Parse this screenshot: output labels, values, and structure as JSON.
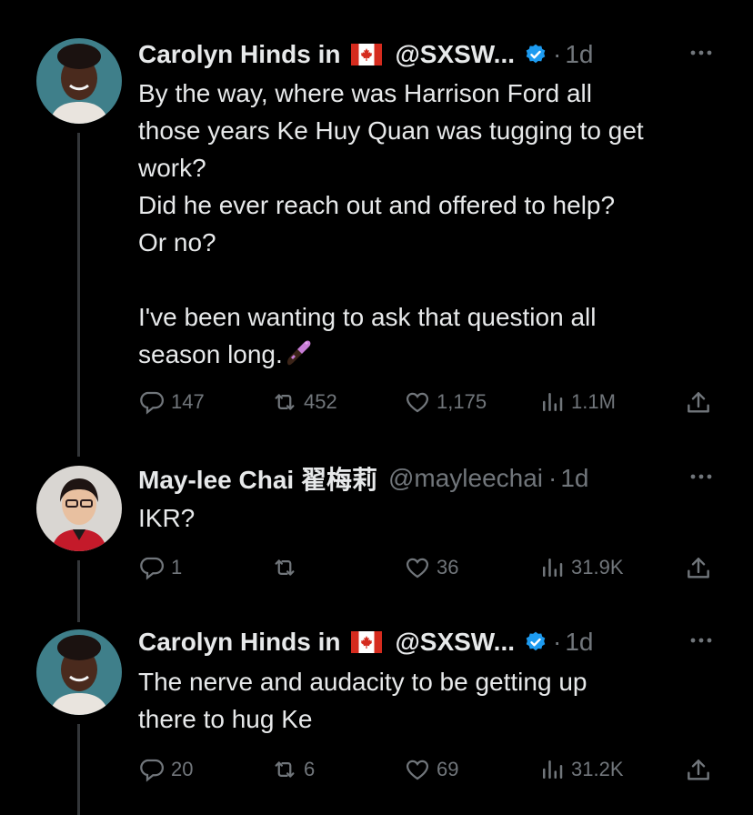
{
  "tweets": [
    {
      "author": "Carolyn Hinds in",
      "handle": "@SXSW...",
      "separator": "·",
      "time": "1d",
      "text": "By the way, where was Harrison Ford all\nthose years Ke Huy Quan was tugging to get\nwork?\nDid he ever reach out and offered to help?\nOr no?\n\nI've been wanting to ask that question all\nseason long.",
      "replies": "147",
      "reposts": "452",
      "likes": "1,175",
      "views": "1.1M"
    },
    {
      "author": "May-lee Chai 翟梅莉",
      "handle": "@mayleechai",
      "separator": "·",
      "time": "1d",
      "text": "IKR?",
      "replies": "1",
      "reposts": "",
      "likes": "36",
      "views": "31.9K"
    },
    {
      "author": "Carolyn Hinds in",
      "handle": "@SXSW...",
      "separator": "·",
      "time": "1d",
      "text": "The nerve and audacity to be getting up\nthere to hug Ke",
      "replies": "20",
      "reposts": "6",
      "likes": "69",
      "views": "31.2K"
    }
  ],
  "colors": {
    "background": "#000000",
    "text": "#e7e9ea",
    "muted": "#71767b",
    "verified": "#1d9bf0",
    "thread_line": "#333639"
  }
}
